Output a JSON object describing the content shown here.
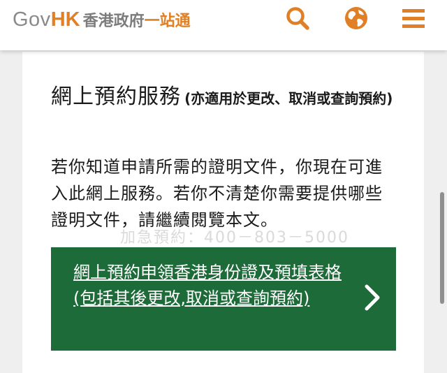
{
  "header": {
    "logo": {
      "gov": "Gov",
      "hk": "HK",
      "zh_part1": "香港政府",
      "zh_part2": "一站通"
    },
    "icons": [
      "search-icon",
      "globe-icon",
      "menu-icon"
    ],
    "accent_color": "#e07f25"
  },
  "content": {
    "title": "網上預約服務",
    "title_note": "(亦適用於更改、取消或查詢預約)",
    "body": "若你知道申請所需的證明文件，你現在可進入此網上服務。若你不清楚你需要提供哪些證明文件，請繼續閱覽本文。",
    "watermark": "加急預約：400－803－5000",
    "cta": {
      "label": "網上預約申領香港身份證及預填表格 (包括其後更改,取消或查詢預約)",
      "color": "#1e6b3a",
      "icon": "chevron-right-icon"
    }
  }
}
